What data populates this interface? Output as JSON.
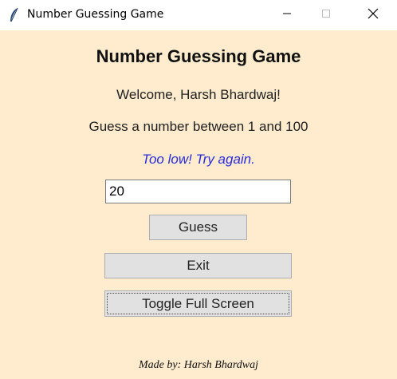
{
  "window": {
    "title": "Number Guessing Game",
    "icon": "feather-icon"
  },
  "controls": {
    "minimize_icon": "minimize-icon",
    "maximize_icon": "maximize-icon",
    "close_icon": "close-icon"
  },
  "game": {
    "heading": "Number Guessing Game",
    "welcome": "Welcome, Harsh Bhardwaj!",
    "prompt": "Guess a number between 1 and 100",
    "feedback": "Too low! Try again.",
    "guess_value": "20",
    "guess_button": "Guess",
    "exit_button": "Exit",
    "fullscreen_button": "Toggle Full Screen",
    "credit": "Made by: Harsh Bhardwaj"
  },
  "colors": {
    "background": "#ffebcd",
    "feedback": "#2b2bdc",
    "button": "#e1e1e1"
  }
}
